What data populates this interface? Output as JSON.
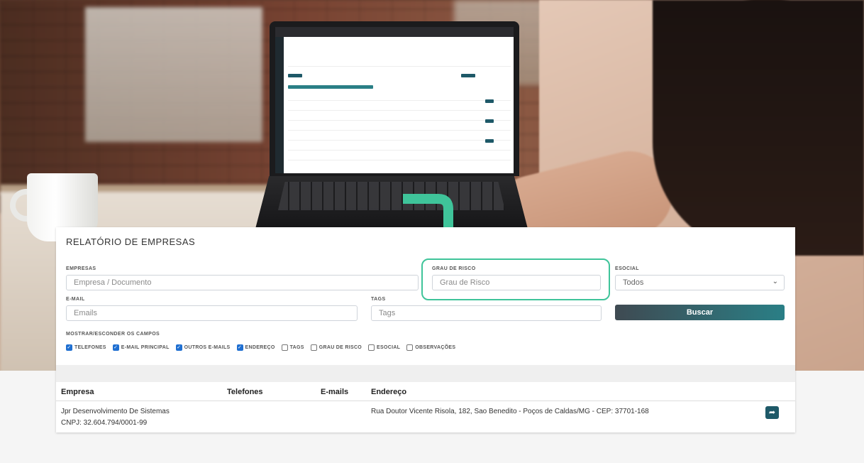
{
  "report": {
    "title": "RELATÓRIO DE EMPRESAS",
    "empresas": {
      "label": "EMPRESAS",
      "placeholder": "Empresa / Documento"
    },
    "grau_risco": {
      "label": "GRAU DE RISCO",
      "placeholder": "Grau de Risco"
    },
    "esocial": {
      "label": "ESOCIAL",
      "value": "Todos"
    },
    "email": {
      "label": "E-MAIL",
      "placeholder": "Emails"
    },
    "tags": {
      "label": "TAGS",
      "placeholder": "Tags"
    },
    "search_button": "Buscar",
    "toggle_label": "MOSTRAR/ESCONDER OS CAMPOS",
    "toggles": [
      {
        "label": "TELEFONES",
        "checked": true
      },
      {
        "label": "E-MAIL PRINCIPAL",
        "checked": true
      },
      {
        "label": "OUTROS E-MAILS",
        "checked": true
      },
      {
        "label": "ENDEREÇO",
        "checked": true
      },
      {
        "label": "TAGS",
        "checked": false
      },
      {
        "label": "GRAU DE RISCO",
        "checked": false
      },
      {
        "label": "ESOCIAL",
        "checked": false
      },
      {
        "label": "OBSERVAÇÕES",
        "checked": false
      }
    ]
  },
  "table": {
    "headers": {
      "empresa": "Empresa",
      "telefones": "Telefones",
      "emails": "E-mails",
      "endereco": "Endereço"
    },
    "rows": [
      {
        "empresa": "Jpr Desenvolvimento De Sistemas",
        "cnpj": "CNPJ: 32.604.794/0001-99",
        "endereco": "Rua Doutor Vicente Risola, 182, Sao Benedito - Poços de Caldas/MG - CEP: 37701-168"
      }
    ]
  },
  "icons": {
    "share": "share-icon",
    "chevron": "chevron-down-icon",
    "arrow": "arrow-down-icon"
  },
  "colors": {
    "accent": "#3fc49a",
    "button_start": "#3f4a52",
    "button_end": "#2a7f86",
    "checkbox": "#1f6fd1"
  }
}
